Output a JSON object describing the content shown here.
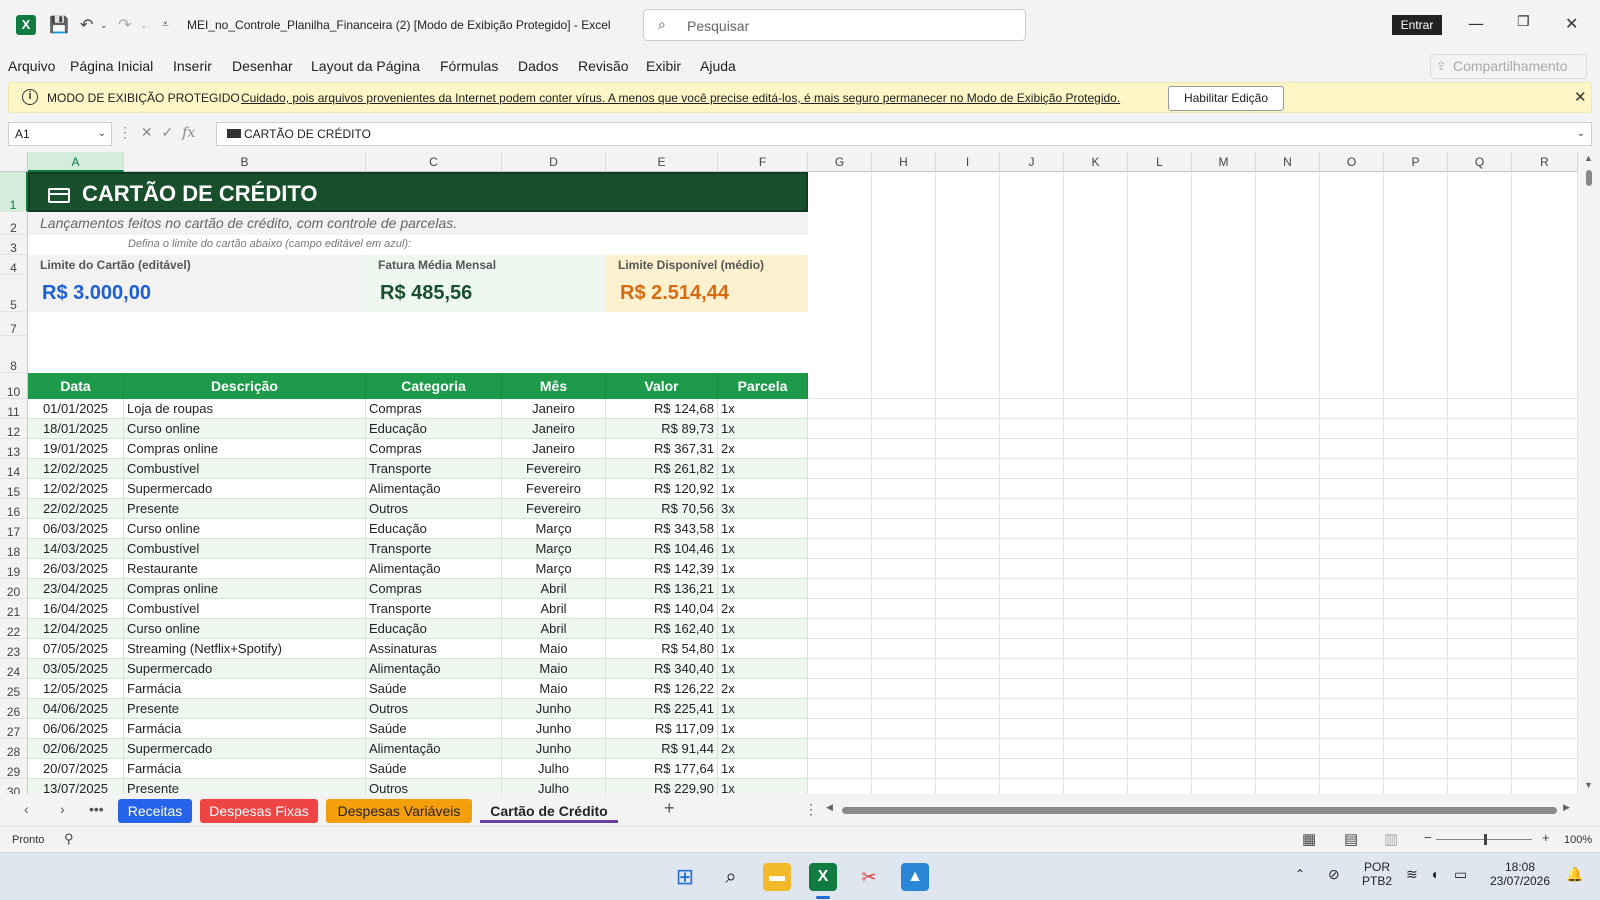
{
  "titlebar": {
    "document_title": "MEI_no_Controle_Planilha_Financeira (2)  [Modo de Exibição Protegido]  -  Excel",
    "search_placeholder": "Pesquisar",
    "signin_label": "Entrar"
  },
  "menu": [
    "Arquivo",
    "Página Inicial",
    "Inserir",
    "Desenhar",
    "Layout da Página",
    "Fórmulas",
    "Dados",
    "Revisão",
    "Exibir",
    "Ajuda"
  ],
  "share_label": "Compartilhamento",
  "protected_bar": {
    "title": "MODO DE EXIBIÇÃO PROTEGIDO",
    "message": "Cuidado, pois arquivos provenientes da Internet podem conter vírus. A menos que você precise editá-los, é mais seguro permanecer no Modo de  Exibição Protegido.",
    "enable_label": "Habilitar Edição"
  },
  "formula_bar": {
    "name_box": "A1",
    "formula": "CARTÃO DE CRÉDITO"
  },
  "columns": [
    "A",
    "B",
    "C",
    "D",
    "E",
    "F",
    "G",
    "H",
    "I",
    "J",
    "K",
    "L",
    "M",
    "N",
    "O",
    "P",
    "Q",
    "R"
  ],
  "rows": [
    "1",
    "2",
    "3",
    "4",
    "5",
    "7",
    "8",
    "10",
    "11",
    "12",
    "13",
    "14",
    "15",
    "16",
    "17",
    "18",
    "19",
    "20",
    "21",
    "22",
    "23",
    "24",
    "25",
    "26",
    "27",
    "28",
    "29",
    "30"
  ],
  "sheet": {
    "title": "CARTÃO DE CRÉDITO",
    "subtitle": "Lançamentos feitos no cartão de crédito, com controle de parcelas.",
    "hint": "Defina o limite do cartão abaixo (campo editável em azul):",
    "kpi_limit_label": "Limite do Cartão (editável)",
    "kpi_limit_value": "R$ 3.000,00",
    "kpi_avg_label": "Fatura Média Mensal",
    "kpi_avg_value": "R$ 485,56",
    "kpi_avail_label": "Limite Disponível (médio)",
    "kpi_avail_value": "R$ 2.514,44",
    "colors": {
      "banner": "#1a4f2e",
      "header": "#1e9b4a",
      "limit": "#1f5fd6",
      "avg": "#1a4f2e",
      "avail": "#d86a10"
    }
  },
  "table": {
    "headers": [
      "Data",
      "Descrição",
      "Categoria",
      "Mês",
      "Valor",
      "Parcela"
    ],
    "rows": [
      [
        "01/01/2025",
        "Loja de roupas",
        "Compras",
        "Janeiro",
        "R$ 124,68",
        "1x"
      ],
      [
        "18/01/2025",
        "Curso online",
        "Educação",
        "Janeiro",
        "R$ 89,73",
        "1x"
      ],
      [
        "19/01/2025",
        "Compras online",
        "Compras",
        "Janeiro",
        "R$ 367,31",
        "2x"
      ],
      [
        "12/02/2025",
        "Combustível",
        "Transporte",
        "Fevereiro",
        "R$ 261,82",
        "1x"
      ],
      [
        "12/02/2025",
        "Supermercado",
        "Alimentação",
        "Fevereiro",
        "R$ 120,92",
        "1x"
      ],
      [
        "22/02/2025",
        "Presente",
        "Outros",
        "Fevereiro",
        "R$ 70,56",
        "3x"
      ],
      [
        "06/03/2025",
        "Curso online",
        "Educação",
        "Março",
        "R$ 343,58",
        "1x"
      ],
      [
        "14/03/2025",
        "Combustível",
        "Transporte",
        "Março",
        "R$ 104,46",
        "1x"
      ],
      [
        "26/03/2025",
        "Restaurante",
        "Alimentação",
        "Março",
        "R$ 142,39",
        "1x"
      ],
      [
        "23/04/2025",
        "Compras online",
        "Compras",
        "Abril",
        "R$ 136,21",
        "1x"
      ],
      [
        "16/04/2025",
        "Combustível",
        "Transporte",
        "Abril",
        "R$ 140,04",
        "2x"
      ],
      [
        "12/04/2025",
        "Curso online",
        "Educação",
        "Abril",
        "R$ 162,40",
        "1x"
      ],
      [
        "07/05/2025",
        "Streaming (Netflix+Spotify)",
        "Assinaturas",
        "Maio",
        "R$ 54,80",
        "1x"
      ],
      [
        "03/05/2025",
        "Supermercado",
        "Alimentação",
        "Maio",
        "R$ 340,40",
        "1x"
      ],
      [
        "12/05/2025",
        "Farmácia",
        "Saúde",
        "Maio",
        "R$ 126,22",
        "2x"
      ],
      [
        "04/06/2025",
        "Presente",
        "Outros",
        "Junho",
        "R$ 225,41",
        "1x"
      ],
      [
        "06/06/2025",
        "Farmácia",
        "Saúde",
        "Junho",
        "R$ 117,09",
        "1x"
      ],
      [
        "02/06/2025",
        "Supermercado",
        "Alimentação",
        "Junho",
        "R$ 91,44",
        "2x"
      ],
      [
        "20/07/2025",
        "Farmácia",
        "Saúde",
        "Julho",
        "R$ 177,64",
        "1x"
      ],
      [
        "13/07/2025",
        "Presente",
        "Outros",
        "Julho",
        "R$ 229,90",
        "1x"
      ]
    ]
  },
  "sheet_tabs": [
    {
      "label": "Receitas",
      "bg": "#2563eb",
      "fg": "#ffffff"
    },
    {
      "label": "Despesas Fixas",
      "bg": "#ef4444",
      "fg": "#ffffff"
    },
    {
      "label": "Despesas Variáveis",
      "bg": "#f59e0b",
      "fg": "#222222"
    },
    {
      "label": "Cartão de Crédito",
      "bg": "#f3f3f3",
      "fg": "#222222"
    }
  ],
  "status": {
    "ready": "Pronto",
    "zoom": "100%"
  },
  "taskbar": {
    "lang1": "POR",
    "lang2": "PTB2",
    "time": "18:08",
    "date": "23/07/2026"
  }
}
